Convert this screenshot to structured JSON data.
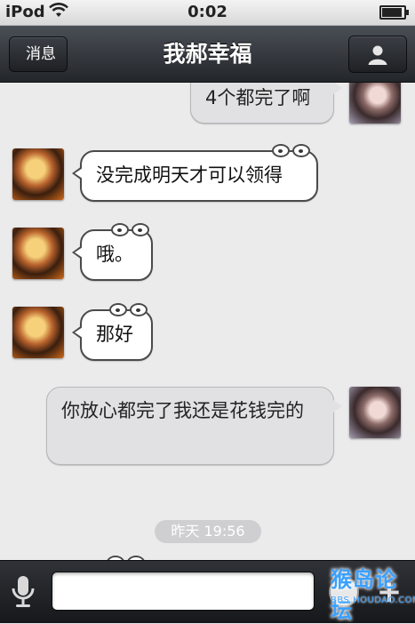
{
  "status_bar": {
    "carrier": "iPod",
    "time": "0:02",
    "battery_level": 0.85
  },
  "nav": {
    "back_label": "消息",
    "title": "我郝幸福",
    "profile_icon": "person-icon"
  },
  "messages": [
    {
      "side": "right",
      "text": "4个都完了啊"
    },
    {
      "side": "left",
      "text": "没完成明天才可以领得"
    },
    {
      "side": "left",
      "text": "哦。"
    },
    {
      "side": "left",
      "text": "那好"
    },
    {
      "side": "right",
      "text": "你放心都完了我还是花钱完的"
    }
  ],
  "timestamp": "昨天 19:56",
  "input_bar": {
    "voice_icon": "microphone-icon",
    "text_value": "",
    "emoji_icon": "emoji-icon",
    "more_icon": "plus-icon"
  },
  "watermark": {
    "name": "猴岛论坛",
    "url": "BBS.HOUDAO.COM"
  }
}
